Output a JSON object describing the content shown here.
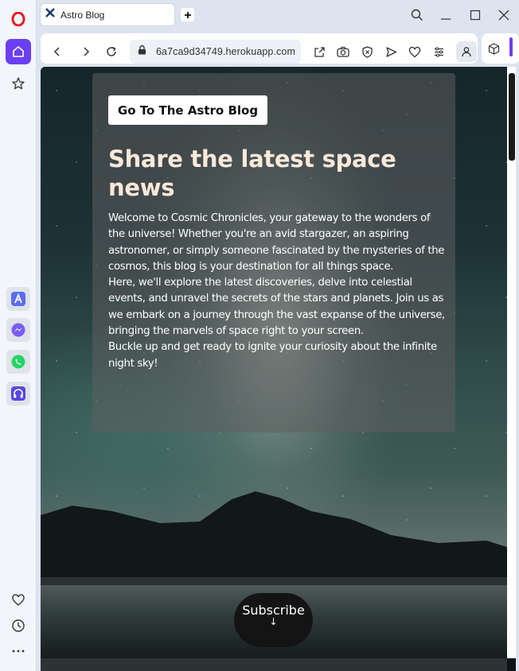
{
  "browser": {
    "tab_title": "Astro Blog",
    "url": "6a7ca9d34749.herokuapp.com"
  },
  "icons": {
    "sidebar": [
      "opera-logo-icon",
      "home-icon",
      "star-icon",
      "aria-icon",
      "messenger-icon",
      "whatsapp-icon",
      "music-icon",
      "heart-icon",
      "history-icon",
      "more-icon"
    ],
    "toolbar": [
      "back-icon",
      "forward-icon",
      "reload-icon",
      "lock-icon",
      "share-icon",
      "camera-icon",
      "shield-icon",
      "send-icon",
      "heart-icon",
      "easy-setup-icon",
      "profile-icon",
      "cube-icon"
    ],
    "window": [
      "search-icon",
      "minimize-icon",
      "maximize-icon",
      "close-icon"
    ]
  },
  "colors": {
    "accent": "#6b3ff2",
    "headline": "#fde9da",
    "card_bg": "rgba(95,95,95,0.55)"
  },
  "page": {
    "blog_button": "Go To The Astro Blog",
    "headline": "Share the latest space news",
    "paragraphs": [
      "Welcome to Cosmic Chronicles, your gateway to the wonders of the universe! Whether you're an avid stargazer, an aspiring astronomer, or simply someone fascinated by the mysteries of the cosmos, this blog is your destination for all things space.",
      "Here, we'll explore the latest discoveries, delve into celestial events, and unravel the secrets of the stars and planets. Join us as we embark on a journey through the vast expanse of the universe, bringing the marvels of space right to your screen.",
      "Buckle up and get ready to ignite your curiosity about the infinite night sky!"
    ],
    "subscribe_label": "Subscribe",
    "subscribe_arrow": "↓"
  }
}
